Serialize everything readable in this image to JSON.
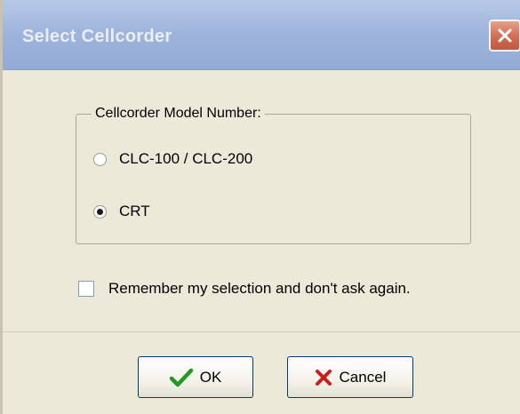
{
  "window": {
    "title": "Select Cellcorder"
  },
  "group": {
    "legend": "Cellcorder Model Number:",
    "options": [
      {
        "label": "CLC-100 / CLC-200",
        "selected": false
      },
      {
        "label": "CRT",
        "selected": true
      }
    ]
  },
  "remember": {
    "label": "Remember my selection and don't ask again.",
    "checked": false
  },
  "buttons": {
    "ok_label": "OK",
    "cancel_label": "Cancel"
  },
  "icons": {
    "close": "close-icon",
    "ok": "checkmark-icon",
    "cancel": "x-icon"
  },
  "colors": {
    "titlebar": "#9fb5dc",
    "close_button": "#cf6d52",
    "ok_icon": "#1e9a1e",
    "cancel_icon": "#c81e1e",
    "dialog_background": "#ece9d8"
  }
}
